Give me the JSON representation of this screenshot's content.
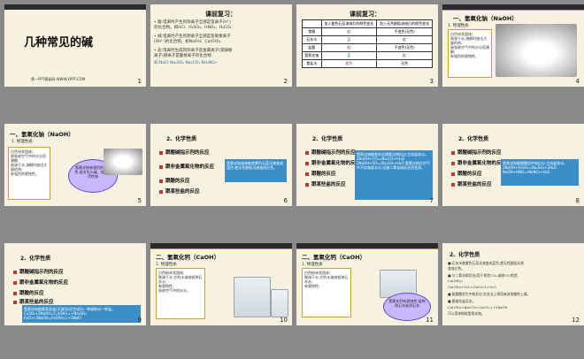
{
  "slides": [
    {
      "num": "1",
      "title": "几种常见的碱",
      "footer": "第一PPT模板网-WWW.1PPT.COM"
    },
    {
      "num": "2",
      "title": "课前复习：",
      "lines": [
        "• 酸:电离时产生的阳离子全部是氢离子(H⁺)",
        "  的化合物。如HCl、H₂SO₄、HNO₃、H₂CO₃",
        "• 碱:电离时产生的阴离子全部是氢氧根离子",
        "  (OH⁻)的化合物。如NaOH、Ca(OH)₂",
        "• 盐:电离时生成的阳离子是金属离子(或铵根",
        "  离子)阴离子是酸根离子的化合物",
        "如:NaCl  Na₂SO₄  Na₂CO₃  NH₄NO₃"
      ]
    },
    {
      "num": "3",
      "title": "课前复习：",
      "header": [
        "",
        "加入紫色石蕊溶液后的颜色变化",
        "加入无色酚酞溶液后的颜色变化"
      ],
      "rows": [
        [
          "食醋",
          "红",
          "不变色(无色)"
        ],
        [
          "石灰水",
          "蓝",
          "红"
        ],
        [
          "盐酸",
          "红",
          "不变色(无色)"
        ],
        [
          "氢氧化钠",
          "蓝",
          "红"
        ],
        [
          "食盐水",
          "紫色",
          "无色"
        ]
      ]
    },
    {
      "num": "4",
      "title": "一、氢氧化钠（NaOH）",
      "sub": "1. 物理性质",
      "lines": [
        "白色块状固体;",
        "易溶于水,溶解时放出大量的热;",
        "易吸收空气中的水分而潮解;",
        "有强烈的腐蚀性。"
      ]
    },
    {
      "num": "5",
      "title": "一、氢氧化钠（NaOH）",
      "sub": "1. 物理性质",
      "lines": [
        "白色块状固体;",
        "易吸收空气中的水分而潮解;",
        "易溶于水,溶解时放出大量的热;",
        "有强烈的腐蚀性。"
      ],
      "cloud": "氢氧化钠有强烈的腐蚀性,俗名叫火碱、烧碱或苛性钠"
    },
    {
      "num": "6",
      "title": "2、化学性质",
      "items": [
        "跟酸碱指示剂的反应",
        "跟非金属氧化物的反应",
        "跟酸的反应",
        "跟某些盐的反应"
      ],
      "note": "氢氧化钠溶液能使紫色石蕊试液变成蓝色,使无色酚酞试液变成红色。"
    },
    {
      "num": "7",
      "title": "2、化学性质",
      "items": [
        "跟酸碱指示剂的反应",
        "跟非金属氧化物的反应",
        "跟酸的反应",
        "跟某些盐的反应"
      ],
      "note": "氢氧化钠能跟非金属氧化物反应,生成盐和水。 2NaOH+CO₂=Na₂CO₃+H₂O 2NaOH+SO₂=Na₂SO₃+H₂O 氢氧化钠在空气中不仅吸收水分,还跟二氧化碳反应而变质。"
    },
    {
      "num": "8",
      "title": "2、化学性质",
      "items": [
        "跟酸碱指示剂的反应",
        "跟非金属氧化物的反应",
        "跟酸的反应",
        "跟某些盐的反应"
      ],
      "note": "氢氧化钠能跟酸起中和反应,生成盐和水。 2NaOH+H₂SO₄=Na₂SO₄+2H₂O NaOH+HNO₃=NaNO₃+H₂O"
    },
    {
      "num": "9",
      "title": "2、化学性质",
      "items": [
        "跟酸碱指示剂的反应",
        "跟非金属氧化物的反应",
        "跟酸的反应",
        "跟某些盐的反应"
      ],
      "note": "氢氧化钠能跟某些盐(可溶)反应生成另一种碱和另一种盐。 CuSO₄+2NaOH=Cu(OH)₂↓+Na₂SO₄ FeCl₃+3NaOH=Fe(OH)₃↓+3NaCl"
    },
    {
      "num": "10",
      "title": "二、氢氧化钙（CaOH）",
      "sub": "1. 物理性质",
      "lines": [
        "白色粉末状固体;",
        "微溶于水,它的水溶液俗称石灰水;",
        "有腐蚀性;",
        "吸收空气中的水分。"
      ]
    },
    {
      "num": "11",
      "title": "二、氢氧化钙（CaOH）",
      "sub": "1. 物理性质",
      "lines": [
        "白色粉末状固体;",
        "微溶于水,它的水溶液俗称石灰水;",
        "有腐蚀性;"
      ],
      "cloud": "氢氧化钙有腐蚀性,俗称熟石灰或消石灰"
    },
    {
      "num": "12",
      "title": "2、化学性质",
      "lines": [
        "■ 石灰水使紫色石蕊试液变成蓝色,使无色酚酞试液",
        "  变成红色。",
        "■ 与二氧化碳反应(用于检验CO₂,或除CO₂检验",
        "  Ca(OH)₂)",
        "  Ca(OH)₂+CO₂=CaCO₃↓+H₂O",
        "■ 能跟酸发生中和反应,在农业上常用来改良酸性土壤。",
        "■ 跟某些盐反应。",
        "  Ca(OH)₂+Na₂CO₃=CaCO₃↓+2NaOH",
        "  可以用来制取氢氧化钠。"
      ]
    }
  ],
  "colors": {
    "accent_red": "#c0392b",
    "blue_box": "#3b8ec8",
    "bg": "#f7f2df",
    "dark_bar": "#2b2b2b"
  }
}
